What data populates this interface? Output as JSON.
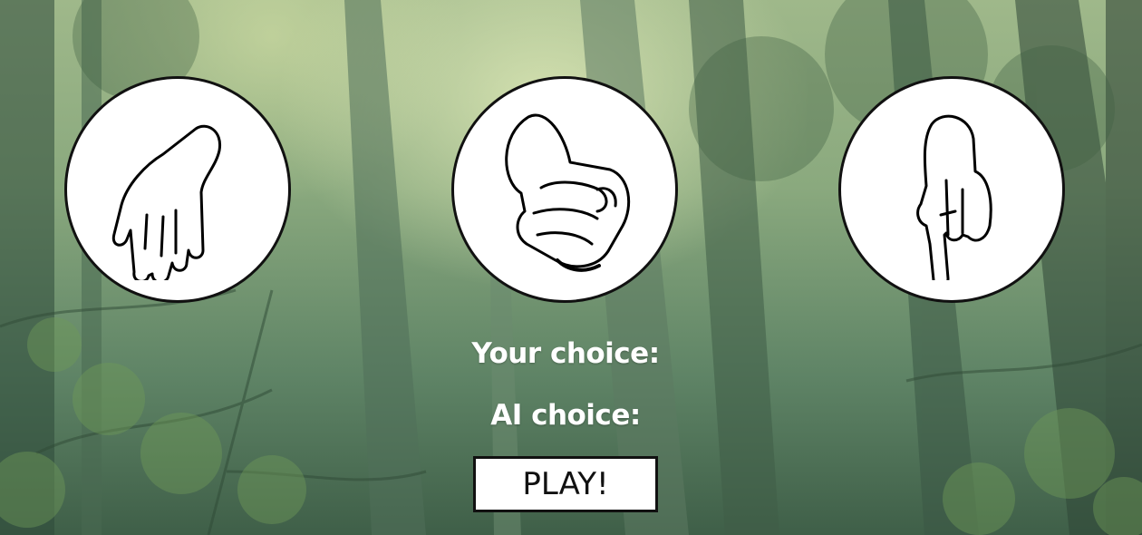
{
  "choices": [
    {
      "id": "paper",
      "icon": "paper-hand-icon"
    },
    {
      "id": "rock",
      "icon": "rock-fist-icon"
    },
    {
      "id": "scissors",
      "icon": "scissors-hand-icon"
    }
  ],
  "status": {
    "your_choice_label": "Your choice:",
    "ai_choice_label": "AI choice:"
  },
  "controls": {
    "play_label": "PLAY!"
  },
  "colors": {
    "circle_fill": "#ffffff",
    "circle_border": "#111111",
    "text": "#ffffff"
  }
}
